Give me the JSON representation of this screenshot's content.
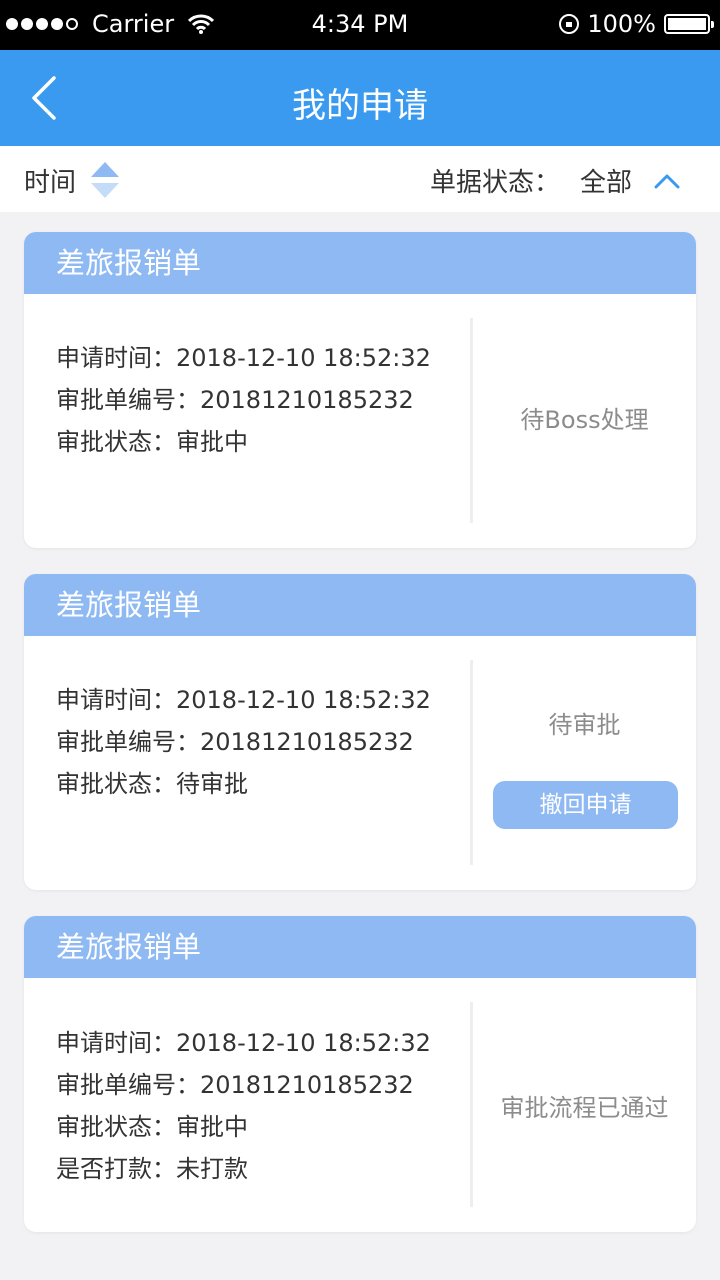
{
  "status_bar": {
    "carrier": "Carrier",
    "time": "4:34 PM",
    "battery": "100%"
  },
  "nav": {
    "title": "我的申请"
  },
  "filter": {
    "sort_label": "时间",
    "status_label": "单据状态：",
    "status_value": "全部"
  },
  "cards": [
    {
      "header": "差旅报销单",
      "rows": [
        "申请时间：2018-12-10 18:52:32",
        "审批单编号：20181210185232",
        "审批状态：审批中"
      ],
      "status": "待Boss处理"
    },
    {
      "header": "差旅报销单",
      "rows": [
        "申请时间：2018-12-10 18:52:32",
        "审批单编号：20181210185232",
        "审批状态：待审批"
      ],
      "status": "待审批",
      "action": "撤回申请"
    },
    {
      "header": "差旅报销单",
      "rows": [
        "申请时间：2018-12-10 18:52:32",
        "审批单编号：20181210185232",
        "审批状态：审批中",
        "是否打款：未打款"
      ],
      "status": "审批流程已通过"
    }
  ],
  "colors": {
    "nav_bg": "#3a9af0",
    "card_header_bg": "#8fb9f3",
    "page_bg": "#f2f2f4",
    "status_text": "#8c8c8c"
  },
  "icons": {
    "back": "chevron-left-icon",
    "sort": "sort-arrows-icon",
    "filter_toggle": "chevron-up-icon",
    "wifi": "wifi-icon",
    "lock": "orientation-lock-icon",
    "battery": "battery-icon"
  }
}
